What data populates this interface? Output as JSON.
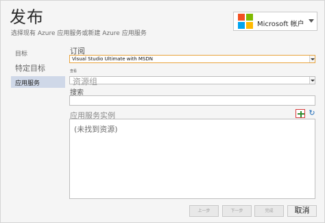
{
  "header": {
    "title": "发布",
    "subtitle": "选择现有 Azure 应用服务或新建 Azure 应用服务"
  },
  "account": {
    "label": "Microsoft 帐户",
    "logo_colors": [
      "#f25022",
      "#7fba00",
      "#00a4ef",
      "#ffb900"
    ]
  },
  "nav": {
    "items": [
      {
        "label": "目标"
      },
      {
        "label": "特定目标"
      },
      {
        "label": "应用服务"
      }
    ]
  },
  "form": {
    "subscription_label": "订阅",
    "subscription_value": "Visual Studio Ultimate with MSDN",
    "view_label": "查看",
    "resource_group_value": "资源组",
    "search_label": "搜索",
    "search_value": "",
    "instances_label": "应用服务实例",
    "instances_empty": "(未找到资源)",
    "refresh_icon": "↻"
  },
  "footer": {
    "prev_label": "上一步",
    "next_label": "下一步",
    "finish_label": "完成",
    "cancel_label": "取消"
  }
}
